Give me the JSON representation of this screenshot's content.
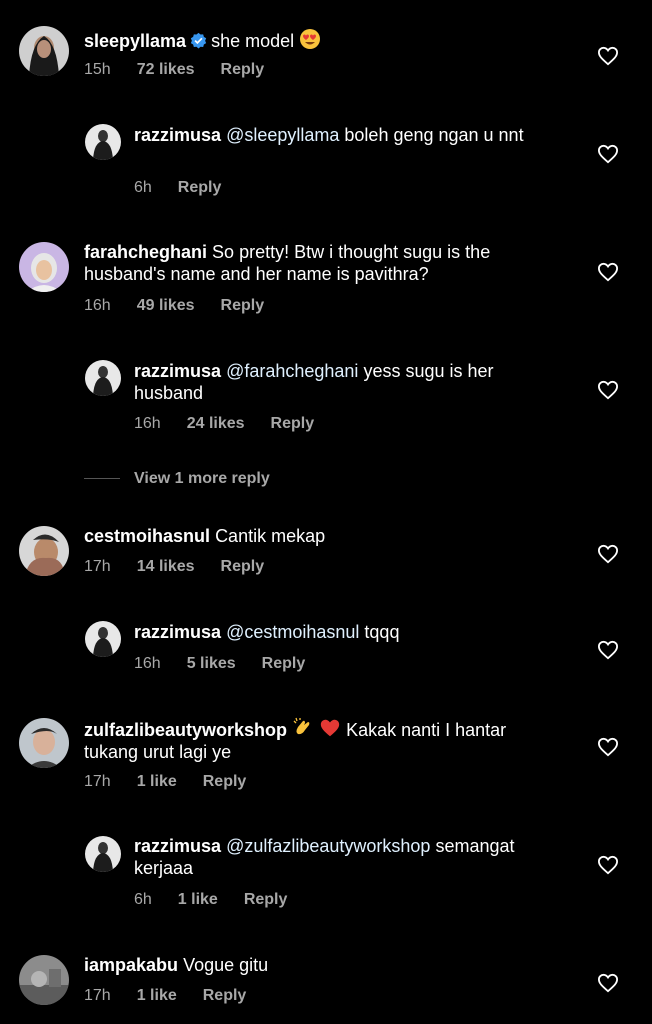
{
  "comments": [
    {
      "user": "sleepyllama",
      "verified": true,
      "text": "she model",
      "emoji": "heart-eyes",
      "time": "15h",
      "likes": "72 likes",
      "reply": "Reply"
    },
    {
      "user": "razzimusa",
      "mention": "@sleepyllama",
      "text": "boleh geng ngan u nnt",
      "time": "6h",
      "likes": "",
      "reply": "Reply"
    },
    {
      "user": "farahcheghani",
      "text": "So pretty! Btw i thought sugu is the husband's name and her name is pavithra?",
      "time": "16h",
      "likes": "49 likes",
      "reply": "Reply"
    },
    {
      "user": "razzimusa",
      "mention": "@farahcheghani",
      "text": "yess sugu is her husband",
      "time": "16h",
      "likes": "24 likes",
      "reply": "Reply"
    },
    {
      "user": "cestmoihasnul",
      "text": "Cantik mekap",
      "time": "17h",
      "likes": "14 likes",
      "reply": "Reply"
    },
    {
      "user": "razzimusa",
      "mention": "@cestmoihasnul",
      "text": "tqqq",
      "time": "16h",
      "likes": "5 likes",
      "reply": "Reply"
    },
    {
      "user": "zulfazlibeautyworkshop",
      "emoji": "clap-heart",
      "text": "Kakak nanti I hantar tukang urut lagi ye",
      "time": "17h",
      "likes": "1 like",
      "reply": "Reply"
    },
    {
      "user": "razzimusa",
      "mention": "@zulfazlibeautyworkshop",
      "text": "semangat kerjaaa",
      "time": "6h",
      "likes": "1 like",
      "reply": "Reply"
    },
    {
      "user": "iampakabu",
      "text": "Vogue gitu",
      "time": "17h",
      "likes": "1 like",
      "reply": "Reply"
    }
  ],
  "view_more": "View 1 more reply",
  "colors": {
    "background": "#000000",
    "text": "#ffffff",
    "meta": "#a8a8a8",
    "verified": "#3897f0"
  }
}
